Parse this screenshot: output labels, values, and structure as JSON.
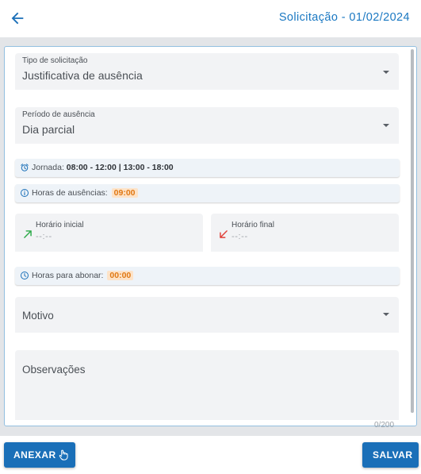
{
  "header": {
    "title": "Solicitação - 01/02/2024"
  },
  "form": {
    "request_type": {
      "label": "Tipo de solicitação",
      "value": "Justificativa de ausência"
    },
    "absence_period": {
      "label": "Período de ausência",
      "value": "Dia parcial"
    },
    "shift": {
      "label": "Jornada:",
      "value": "08:00 - 12:00 | 13:00 - 18:00"
    },
    "absence_hours": {
      "label": "Horas de ausências:",
      "value": "09:00"
    },
    "start_time": {
      "label": "Horário inicial",
      "placeholder": "--:--"
    },
    "end_time": {
      "label": "Horário final",
      "placeholder": "--:--"
    },
    "hours_to_pay": {
      "label": "Horas para abonar:",
      "value": "00:00"
    },
    "reason": {
      "label": "Motivo"
    },
    "notes": {
      "label": "Observações",
      "counter": "0/200"
    }
  },
  "footer": {
    "attach_label": "ANEXAR",
    "save_label": "SALVAR"
  },
  "colors": {
    "accent": "#1a6fb8",
    "header_text": "#1a78c2",
    "badge_bg": "#fde3c8",
    "badge_text": "#e07813",
    "start_arrow": "#2eaa4a",
    "end_arrow": "#e0413a"
  },
  "icons": {
    "back": "arrow-left-icon",
    "alarm": "alarm-clock-icon",
    "info": "info-circle-icon",
    "start": "arrow-up-right-icon",
    "end": "arrow-down-left-icon",
    "clock": "clock-icon",
    "attach": "hand-pointer-icon"
  }
}
